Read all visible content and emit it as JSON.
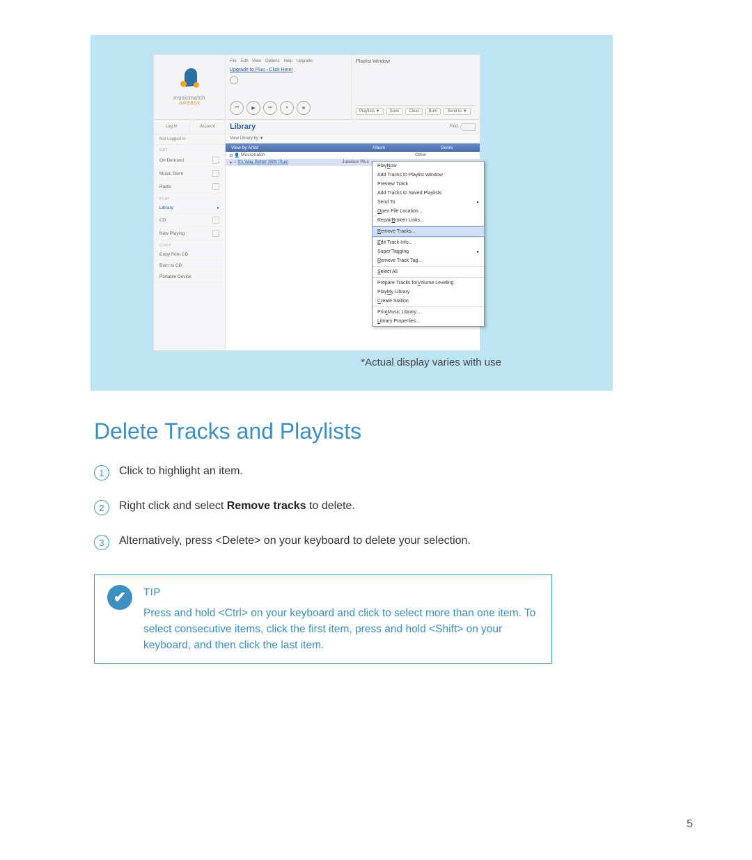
{
  "caption": "*Actual display varies with use",
  "doc_title": "Delete Tracks and Playlists",
  "page_number": "5",
  "steps": [
    {
      "num": "1",
      "text": "Click to highlight an item."
    },
    {
      "num": "2",
      "pre": "Right click and select ",
      "bold": "Remove tracks",
      "post": " to delete."
    },
    {
      "num": "3",
      "text": "Alternatively, press <Delete> on your keyboard to delete your selection."
    }
  ],
  "tip": {
    "title": "TIP",
    "body": "Press and hold <Ctrl> on your keyboard and click to select more than one item. To select consecutive items, click the first item, press and hold <Shift> on your keyboard, and then click the last item."
  },
  "app": {
    "logo_text": "musicmatch",
    "logo_sub": "JUKEBOX",
    "menubar": [
      "File",
      "Edit",
      "View",
      "Options",
      "Help",
      "Upgrade"
    ],
    "upgrade_link": "Upgrade to Plus - Click Here!",
    "playlist_title": "Playlist Window",
    "playlist_buttons": [
      "Playlists ▼",
      "Save",
      "Clear",
      "Burn",
      "Send to ▼"
    ],
    "login": {
      "left": "Log In",
      "right": "Account"
    },
    "not_logged": "Not Logged In",
    "library_title": "Library",
    "find_label": "Find:",
    "view_by": "View Library by ▼",
    "columns": {
      "c1": "View by Artist",
      "c2": "Album",
      "c3": "Genre"
    },
    "tree": {
      "root": "Musicmatch",
      "item": {
        "name": "It's Way Better With Plus!",
        "album": "Jukebox Plus",
        "genre": "Other"
      },
      "genre_root": "Other"
    },
    "sidebar": {
      "sections": [
        {
          "label": "GET",
          "items": [
            "On Demand",
            "Music Store",
            "Radio"
          ]
        },
        {
          "label": "PLAY",
          "items": [
            "Library",
            "CD",
            "Now Playing"
          ]
        },
        {
          "label": "COPY",
          "items": [
            "Copy from CD",
            "Burn to CD",
            "Portable Device"
          ]
        }
      ]
    },
    "context_menu": [
      {
        "label": "Play Now",
        "u": "N"
      },
      {
        "label": "Add Tracks to Playlist Window"
      },
      {
        "label": "Preview Track"
      },
      {
        "label": "Add Tracks to Saved Playlists"
      },
      {
        "label": "Send To",
        "arrow": true
      },
      {
        "label": "Open File Location...",
        "u": "O"
      },
      {
        "label": "Repair Broken Links...",
        "u": "B"
      },
      {
        "sep": true
      },
      {
        "label": "Remove Tracks...",
        "u": "R",
        "selected": true
      },
      {
        "sep": true
      },
      {
        "label": "Edit Track Info...",
        "u": "E"
      },
      {
        "label": "Super Tagging",
        "arrow": true
      },
      {
        "label": "Remove Track Tag...",
        "u": "R"
      },
      {
        "sep": true
      },
      {
        "label": "Select All",
        "u": "S"
      },
      {
        "sep": true
      },
      {
        "label": "Prepare Tracks for Volume Leveling",
        "u": "V"
      },
      {
        "label": "Play My Library",
        "u": "M"
      },
      {
        "label": "Create Station",
        "u": "C"
      },
      {
        "sep": true
      },
      {
        "label": "Print Music Library...",
        "u": "t"
      },
      {
        "label": "Library Properties...",
        "u": "L"
      }
    ]
  }
}
